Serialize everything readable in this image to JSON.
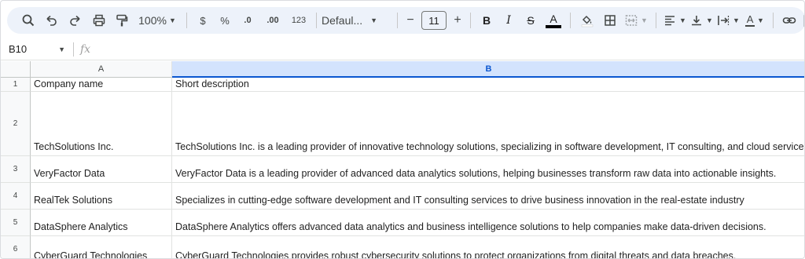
{
  "toolbar": {
    "zoom": "100%",
    "currency_label": "$",
    "percent_label": "%",
    "decrease_decimal_label": ".0",
    "increase_decimal_label": ".00",
    "format_123_label": "123",
    "font_name": "Defaul...",
    "font_size": "11",
    "minus_label": "−",
    "plus_label": "+",
    "bold_label": "B",
    "italic_label": "I",
    "strike_label": "S",
    "text_color_label": "A",
    "text_rotation_label": "A"
  },
  "formula_bar": {
    "name_box": "B10",
    "fx_label": "fx",
    "formula": ""
  },
  "grid": {
    "columns": [
      "A",
      "B"
    ],
    "selected_column": "B",
    "rows": [
      {
        "num": "1",
        "a": "Company name",
        "b": "Short description"
      },
      {
        "num": "2",
        "a": "TechSolutions Inc.",
        "b": "TechSolutions Inc. is a leading provider of innovative technology solutions, specializing in software development, IT consulting, and cloud services."
      },
      {
        "num": "3",
        "a": "VeryFactor Data",
        "b": "VeryFactor Data is a leading provider of advanced data analytics solutions, helping businesses transform raw data into actionable insights."
      },
      {
        "num": "4",
        "a": "RealTek Solutions",
        "b": "Specializes in cutting-edge software development and IT consulting services to drive business innovation in the real-estate industry"
      },
      {
        "num": "5",
        "a": "DataSphere Analytics",
        "b": "DataSphere Analytics offers advanced data analytics and business intelligence solutions to help companies make data-driven decisions."
      },
      {
        "num": "6",
        "a": "CyberGuard Technologies",
        "b": "CyberGuard Technologies provides robust cybersecurity solutions to protect organizations from digital threats and data breaches."
      }
    ]
  },
  "colors": {
    "toolbar_bg": "#edf2fa",
    "selected_header_bg": "#d3e3fd",
    "selected_header_text": "#0b57d0",
    "grid_line": "#e1e3e1"
  }
}
